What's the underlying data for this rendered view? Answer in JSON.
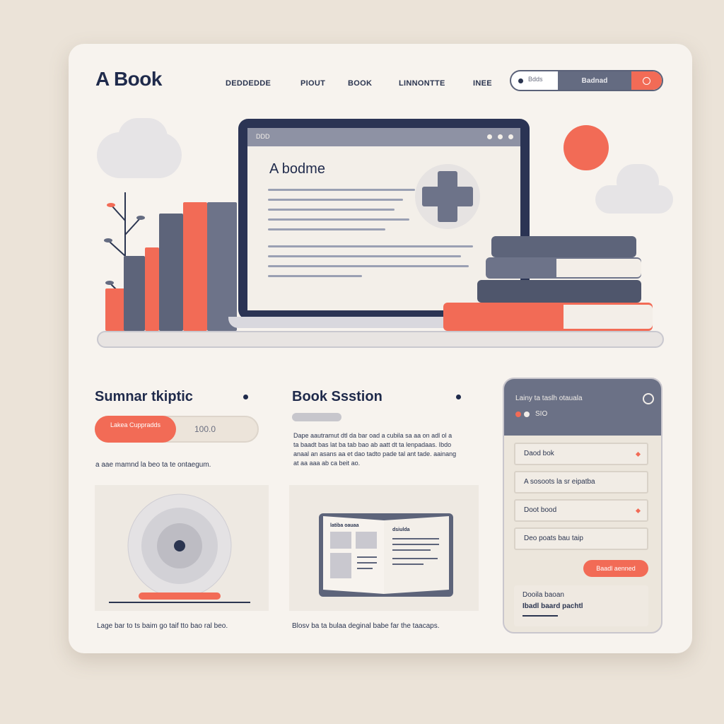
{
  "header": {
    "logo": "A Book",
    "nav": [
      "DEDDEDDE",
      "PIOUT",
      "BOOK",
      "LINNONTTE",
      "INEE"
    ],
    "search": {
      "placeholder": "Bdds",
      "button_label": "Badnad",
      "go_icon": "search-icon"
    }
  },
  "hero": {
    "screen_title": "A bodme",
    "screen_tab_label": "DDD"
  },
  "panels": {
    "summary": {
      "title": "Sumnar tkiptic",
      "pill_label": "Lakea Cuppradds",
      "pill_value": "100.0",
      "caption": "a aae mamnd la beo ta te ontaegum.",
      "footer": "Lage bar to ts baim go taif tto bao ral beo."
    },
    "book_section": {
      "title": "Book Ssstion",
      "body": "Dape aautramut dtl da bar oad a cubila sa aa on adl ol a ta baadt bas lat ba tab bao ab aatt dt ta lenpadaas. Ibdo anaal an asans aa et dao tadto pade tal ant tade. aainang at aa aaa ab ca beit ao.",
      "footer": "Blosv ba ta bulaa deginal babe far the taacaps.",
      "book_left_label": "latiba oauaa",
      "book_right_label": "dsiulda"
    },
    "sidebar": {
      "head_title": "Lainy ta taslh otauala",
      "head_sub": "SIO",
      "items": [
        "Daod bok",
        "A sosoots la sr eipatba",
        "Doot bood",
        "Deo poats bau taip"
      ],
      "button_label": "Baadl aenned",
      "note_line1": "Dooila baoan",
      "note_line2": "Ibadl baard pachtl"
    }
  },
  "colors": {
    "accent": "#f26b56",
    "navy": "#1f2a4b",
    "slate": "#646b81",
    "cream": "#f7f3ee"
  }
}
